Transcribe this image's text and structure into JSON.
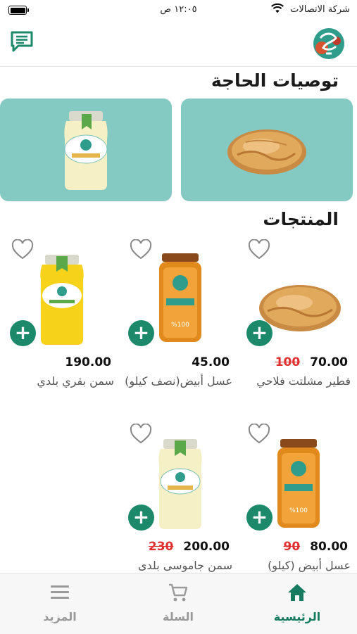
{
  "status_bar": {
    "carrier": "شركة الاتصالات",
    "time": "١٢:٠٥ ص"
  },
  "sections": {
    "recommendations": "توصيات الحاجة",
    "products": "المنتجات"
  },
  "products": [
    {
      "name": "فطير مشلتت فلاحي",
      "price": "70.00",
      "old_price": "100",
      "image": "pie"
    },
    {
      "name": "عسل أبيض(نصف كيلو)",
      "price": "45.00",
      "old_price": "",
      "image": "honey-jar"
    },
    {
      "name": "سمن بقري بلدي",
      "price": "190.00",
      "old_price": "",
      "image": "ghee-yellow"
    },
    {
      "name": "عسل أبيض (كيلو)",
      "price": "80.00",
      "old_price": "90",
      "image": "honey-jar"
    },
    {
      "name": "سمن جاموسى بلدى",
      "price": "200.00",
      "old_price": "230",
      "image": "ghee-white"
    }
  ],
  "nav": {
    "home": "الرئيسية",
    "cart": "السلة",
    "more": "المزيد"
  },
  "colors": {
    "accent": "#1c8a6a",
    "banner": "#84c9c2",
    "old_price": "#e03030"
  },
  "icons": [
    "chat-icon",
    "heart-icon",
    "plus-icon",
    "home-icon",
    "cart-icon",
    "menu-icon"
  ]
}
